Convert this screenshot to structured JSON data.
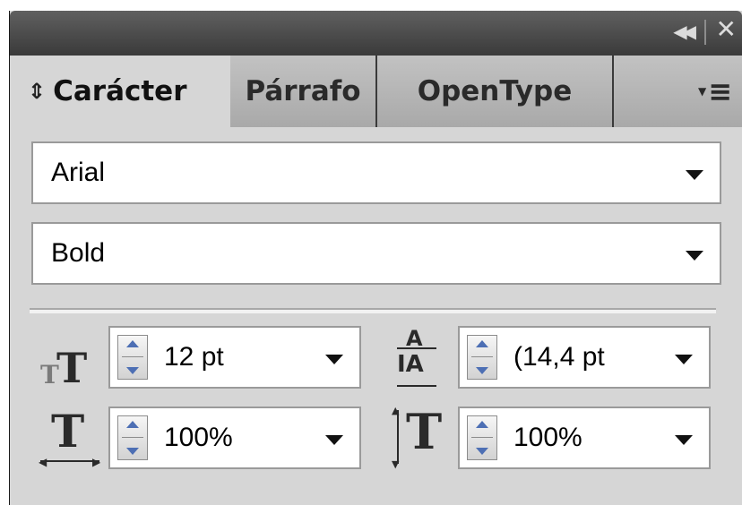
{
  "panel": {
    "titlebar": {
      "collapse_glyph": "◀◀",
      "close_glyph": "✕"
    },
    "tabs": [
      {
        "label": "Carácter",
        "active": true
      },
      {
        "label": "Párrafo"
      },
      {
        "label": "OpenType"
      }
    ],
    "font_family": {
      "value": "Arial"
    },
    "font_style": {
      "value": "Bold"
    },
    "font_size": {
      "value": "12 pt",
      "icon": "font-size-icon"
    },
    "leading": {
      "value": "(14,4 pt",
      "icon": "leading-icon"
    },
    "horizontal_scale": {
      "value": "100%",
      "icon": "horizontal-scale-icon"
    },
    "vertical_scale": {
      "value": "100%",
      "icon": "vertical-scale-icon"
    }
  },
  "colors": {
    "titlebar": "#3a3a3a",
    "panel_bg": "#d6d6d6",
    "spinner_arrow": "#4d6fb4"
  }
}
